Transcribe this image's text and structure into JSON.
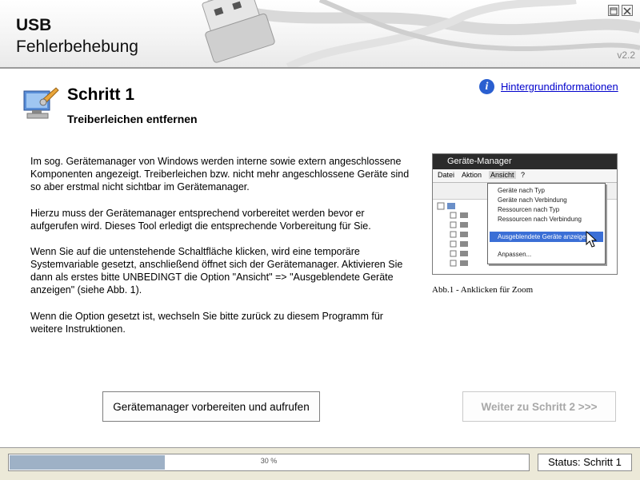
{
  "header": {
    "title_line1": "USB",
    "title_line2": "Fehlerbehebung",
    "version": "v2.2"
  },
  "step": {
    "title": "Schritt 1",
    "subtitle": "Treiberleichen entfernen"
  },
  "info_link": "Hintergrundinformationen",
  "paragraphs": [
    "Im sog. Gerätemanager von Windows werden interne sowie extern angeschlossene Komponenten angezeigt. Treiberleichen bzw. nicht mehr angeschlossene Geräte sind so aber erstmal nicht sichtbar im Gerätemanager.",
    "Hierzu muss der Gerätemanager entsprechend vorbereitet werden bevor er aufgerufen wird. Dieses Tool erledigt die entsprechende Vorbereitung für Sie.",
    "Wenn Sie auf die untenstehende Schaltfläche klicken, wird eine temporäre Systemvariable gesetzt, anschließend öffnet sich der Gerätemanager. Aktivieren Sie dann als erstes bitte UNBEDINGT die Option \"Ansicht\" => \"Ausgeblendete Geräte anzeigen\" (siehe Abb. 1).",
    "Wenn die Option gesetzt ist, wechseln Sie bitte zurück zu diesem Programm für weitere Instruktionen."
  ],
  "screenshot": {
    "window_title": "Geräte-Manager",
    "menu": [
      "Datei",
      "Aktion",
      "Ansicht",
      "?"
    ],
    "popup_items": [
      "Geräte nach Typ",
      "Geräte nach Verbindung",
      "Ressourcen nach Typ",
      "Ressourcen nach Verbindung",
      "Ausgeblendete Geräte anzeigen",
      "Anpassen..."
    ],
    "caption": "Abb.1 - Anklicken für Zoom"
  },
  "buttons": {
    "prepare": "Gerätemanager vorbereiten und aufrufen",
    "next": "Weiter zu Schritt 2  >>>"
  },
  "progress": {
    "value": 0.3,
    "label": "30 %"
  },
  "status": "Status: Schritt 1",
  "colors": {
    "link": "#0000cc",
    "progress_fill": "#9eb1c6",
    "disabled_text": "#a8a8a8"
  },
  "icons": [
    "usb-cable-graphic",
    "computer-wrench-icon",
    "info-icon",
    "minimize-icon",
    "close-icon"
  ]
}
